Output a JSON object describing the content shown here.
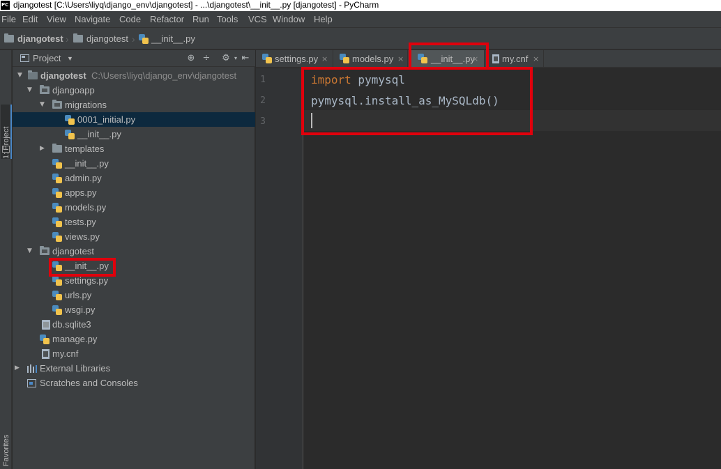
{
  "titlebar": {
    "logo": "PC",
    "text": "djangotest [C:\\Users\\liyq\\django_env\\djangotest] - ...\\djangotest\\__init__.py [djangotest] - PyCharm"
  },
  "menu": {
    "file": "File",
    "edit": "Edit",
    "view": "View",
    "navigate": "Navigate",
    "code": "Code",
    "refactor": "Refactor",
    "run": "Run",
    "tools": "Tools",
    "vcs": "VCS",
    "window": "Window",
    "help": "Help"
  },
  "breadcrumb": {
    "project": "djangotest",
    "package": "djangotest",
    "file": "__init__.py"
  },
  "strip": {
    "project_tab": "1: Project",
    "favorites_tab": "Favorites"
  },
  "project_panel": {
    "title": "Project",
    "dropdown": "▼",
    "icons": [
      "target-icon",
      "collapse-icon",
      "settings-icon",
      "hide-icon"
    ]
  },
  "tree": {
    "root": {
      "label": "djangotest",
      "path": "C:\\Users\\liyq\\django_env\\djangotest"
    },
    "djangoapp": "djangoapp",
    "migrations": "migrations",
    "initial": "0001_initial.py",
    "migrations_init": "__init__.py",
    "templates": "templates",
    "app_init": "__init__.py",
    "admin": "admin.py",
    "apps": "apps.py",
    "models": "models.py",
    "tests": "tests.py",
    "views": "views.py",
    "djangotest_pkg": "djangotest",
    "pkg_init": "__init__.py",
    "settings": "settings.py",
    "urls": "urls.py",
    "wsgi": "wsgi.py",
    "db": "db.sqlite3",
    "manage": "manage.py",
    "mycnf": "my.cnf",
    "external": "External Libraries",
    "scratches": "Scratches and Consoles"
  },
  "tabs": {
    "settings": "settings.py",
    "models": "models.py",
    "init": "__init__.py",
    "mycnf": "my.cnf",
    "close": "×"
  },
  "editor": {
    "line_numbers": [
      "1",
      "2",
      "3"
    ],
    "line1_kw": "import",
    "line1_rest": " pymysql",
    "line2": "pymysql.install_as_MySQLdb()"
  },
  "colors": {
    "highlight": "#e0000c",
    "keyword": "#cc7832",
    "selection": "#0d293e"
  }
}
